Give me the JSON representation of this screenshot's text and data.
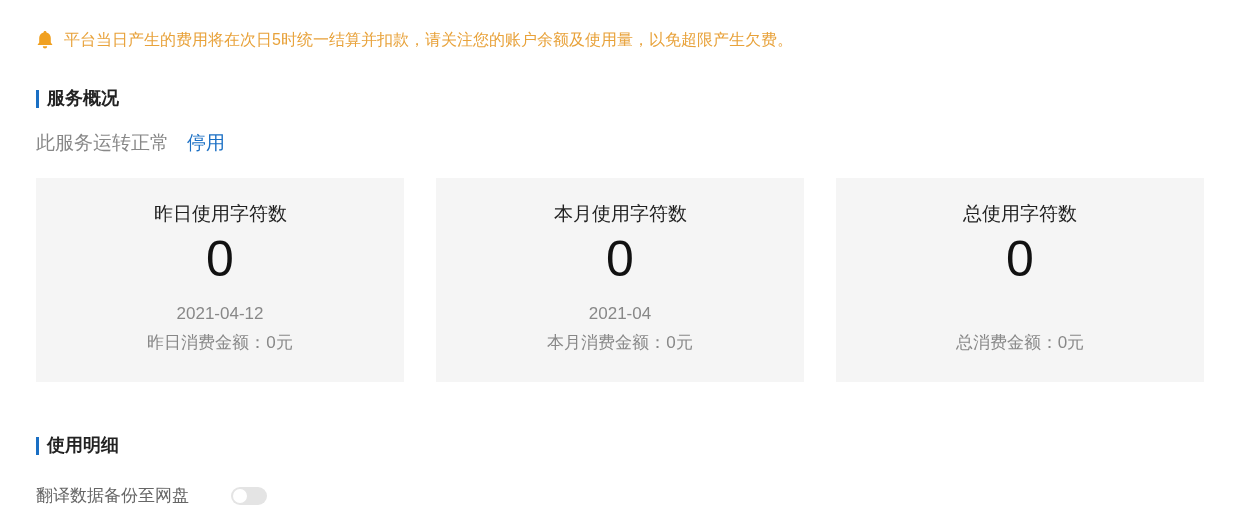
{
  "notice": "平台当日产生的费用将在次日5时统一结算并扣款，请关注您的账户余额及使用量，以免超限产生欠费。",
  "overview": {
    "title": "服务概况",
    "status": "此服务运转正常",
    "action": "停用",
    "cards": [
      {
        "title": "昨日使用字符数",
        "value": "0",
        "date": "2021-04-12",
        "amount": "昨日消费金额：0元"
      },
      {
        "title": "本月使用字符数",
        "value": "0",
        "date": "2021-04",
        "amount": "本月消费金额：0元"
      },
      {
        "title": "总使用字符数",
        "value": "0",
        "amount": "总消费金额：0元"
      }
    ]
  },
  "details": {
    "title": "使用明细",
    "backup": {
      "label": "翻译数据备份至网盘",
      "on": false
    }
  }
}
